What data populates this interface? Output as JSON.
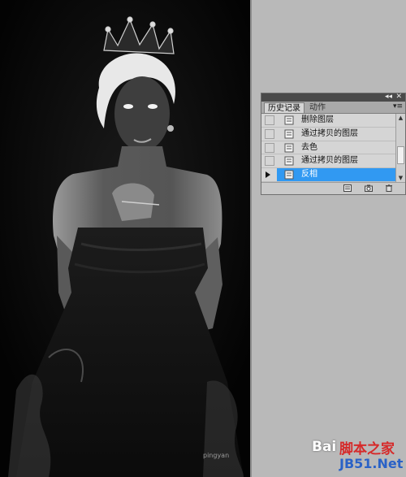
{
  "panel": {
    "tabs": [
      {
        "label": "历史记录",
        "active": true
      },
      {
        "label": "动作",
        "active": false
      }
    ],
    "controls": {
      "collapse": "◂◂",
      "close": "✕",
      "menu": "▾≡"
    },
    "history_items": [
      {
        "label": "删除图层",
        "selected": false
      },
      {
        "label": "通过拷贝的图层",
        "selected": false
      },
      {
        "label": "去色",
        "selected": false
      },
      {
        "label": "通过拷贝的图层",
        "selected": false
      },
      {
        "label": "反相",
        "selected": true
      }
    ],
    "footer_icons": [
      "new-document-from-state-icon",
      "new-snapshot-icon",
      "trash-icon"
    ]
  },
  "watermarks": {
    "baidu": "Bai",
    "site_cn": "脚本之家",
    "site_en": "JB51.Net",
    "pingyan": "pingyan"
  },
  "colors": {
    "selection": "#3199f2",
    "panel_bg": "#d5d5d5",
    "workspace": "#b9b9b9",
    "canvas": "#050505"
  }
}
